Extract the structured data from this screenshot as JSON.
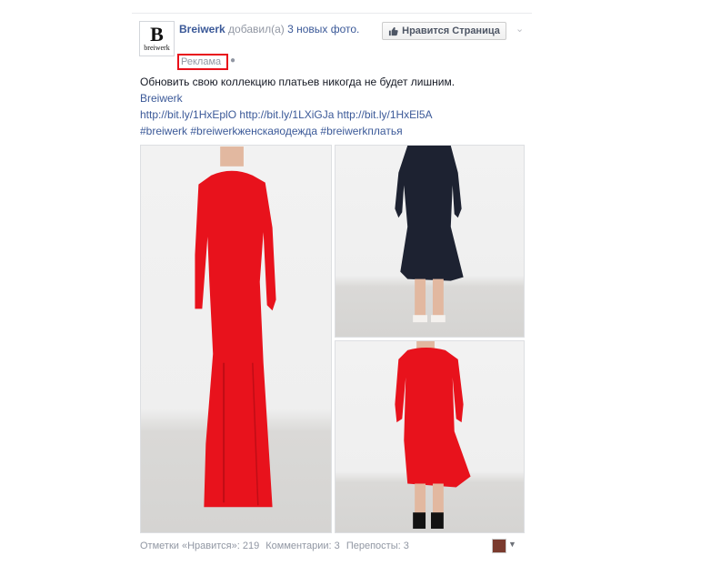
{
  "page": {
    "name": "Breiwerk",
    "action": "добавил(а)",
    "photos_link": "3 новых фото.",
    "sponsored": "Реклама",
    "logo_letter": "B",
    "logo_text": "breiwerk",
    "like_page_button": "Нравится Страница"
  },
  "post": {
    "line1": "Обновить свою коллекцию платьев никогда не будет лишним.",
    "line2": "Breiwerk",
    "links": [
      "http://bit.ly/1HxEplO",
      "http://bit.ly/1LXiGJa",
      "http://bit.ly/1HxEl5A"
    ],
    "hashtags": [
      "#breiwerk",
      "#breiwerkженскаяодежда",
      "#breiwerkплатья"
    ]
  },
  "photos": [
    {
      "label": "red long dress",
      "color": "#e8121c"
    },
    {
      "label": "navy midi dress",
      "color": "#1d2231"
    },
    {
      "label": "red midi dress",
      "color": "#e8121c"
    }
  ],
  "stats": {
    "likes": "Отметки «Нравится»: 219",
    "comments": "Комментарии: 3",
    "shares": "Перепосты: 3"
  },
  "colors": {
    "link": "#3b5998",
    "sponsored_highlight": "#e8101a"
  }
}
